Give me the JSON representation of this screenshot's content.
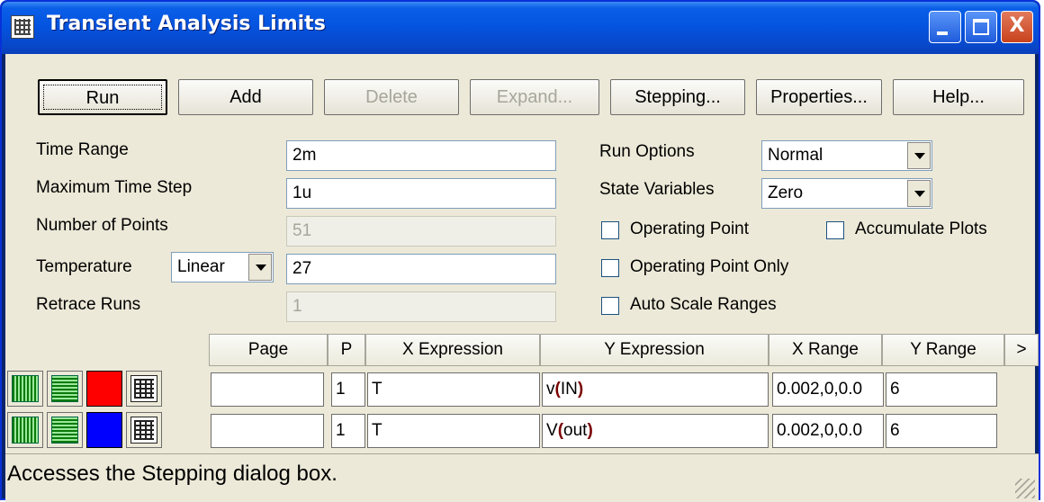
{
  "window": {
    "title": "Transient Analysis Limits",
    "controls": {
      "minimize": "_",
      "maximize": "□",
      "close": "X"
    }
  },
  "toolbar": {
    "run": "Run",
    "add": "Add",
    "delete": "Delete",
    "expand": "Expand...",
    "stepping": "Stepping...",
    "properties": "Properties...",
    "help": "Help..."
  },
  "fields": {
    "time_range": {
      "label": "Time Range",
      "value": "2m"
    },
    "max_time_step": {
      "label": "Maximum Time Step",
      "value": "1u"
    },
    "num_points": {
      "label": "Number of Points",
      "value": "51"
    },
    "temperature": {
      "label": "Temperature",
      "mode": "Linear",
      "value": "27"
    },
    "retrace_runs": {
      "label": "Retrace Runs",
      "value": "1"
    }
  },
  "options": {
    "run_options": {
      "label": "Run Options",
      "value": "Normal"
    },
    "state_variables": {
      "label": "State Variables",
      "value": "Zero"
    },
    "operating_point": {
      "label": "Operating Point",
      "checked": false
    },
    "accumulate_plots": {
      "label": "Accumulate Plots",
      "checked": false
    },
    "operating_point_only": {
      "label": "Operating Point Only",
      "checked": false
    },
    "auto_scale_ranges": {
      "label": "Auto Scale Ranges",
      "checked": false
    }
  },
  "table": {
    "headers": [
      "Page",
      "P",
      "X Expression",
      "Y Expression",
      "X Range",
      "Y Range",
      ">"
    ],
    "rows": [
      {
        "color": "#ff0000",
        "page": "",
        "p": "1",
        "x_expr": "T",
        "y_expr_pre": "v",
        "y_expr_lparen": "(",
        "y_expr_arg": "IN",
        "y_expr_rparen": ")",
        "x_range": "0.002,0,0.0",
        "y_range": "6"
      },
      {
        "color": "#0000ff",
        "page": "",
        "p": "1",
        "x_expr": "T",
        "y_expr_pre": "V",
        "y_expr_lparen": "(",
        "y_expr_arg": "out",
        "y_expr_rparen": ")",
        "x_range": "0.002,0,0.0",
        "y_range": "6"
      }
    ]
  },
  "status": {
    "text": "Accesses the Stepping dialog box."
  }
}
